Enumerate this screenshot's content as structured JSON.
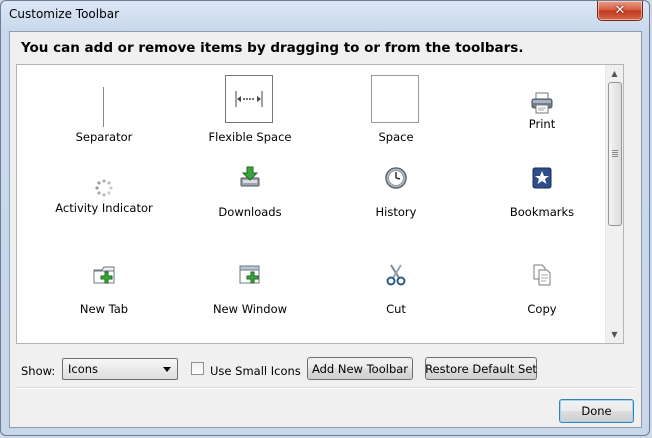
{
  "window": {
    "title": "Customize Toolbar",
    "close_glyph": "✕"
  },
  "instructions": "You can add or remove items by dragging to or from the toolbars.",
  "palette": {
    "items": [
      {
        "label": "Separator",
        "icon": "separator-line"
      },
      {
        "label": "Flexible Space",
        "icon": "flexible-space-icon"
      },
      {
        "label": "Space",
        "icon": "space-box"
      },
      {
        "label": "Print",
        "icon": "printer-icon"
      },
      {
        "label": "Activity Indicator",
        "icon": "throbber-icon"
      },
      {
        "label": "Downloads",
        "icon": "downloads-icon"
      },
      {
        "label": "History",
        "icon": "history-clock-icon"
      },
      {
        "label": "Bookmarks",
        "icon": "bookmark-star-icon"
      },
      {
        "label": "New Tab",
        "icon": "new-tab-icon"
      },
      {
        "label": "New Window",
        "icon": "new-window-icon"
      },
      {
        "label": "Cut",
        "icon": "scissors-icon"
      },
      {
        "label": "Copy",
        "icon": "copy-icon"
      }
    ]
  },
  "controls": {
    "show_label": "Show:",
    "show_value": "Icons",
    "small_icons_label": "Use Small Icons",
    "small_icons_checked": false,
    "add_toolbar_label": "Add New Toolbar",
    "restore_label": "Restore Default Set",
    "done_label": "Done"
  },
  "colors": {
    "close_button": "#c7402a",
    "title_bar": "#c9d8ec",
    "done_border": "#3c7fb1"
  }
}
